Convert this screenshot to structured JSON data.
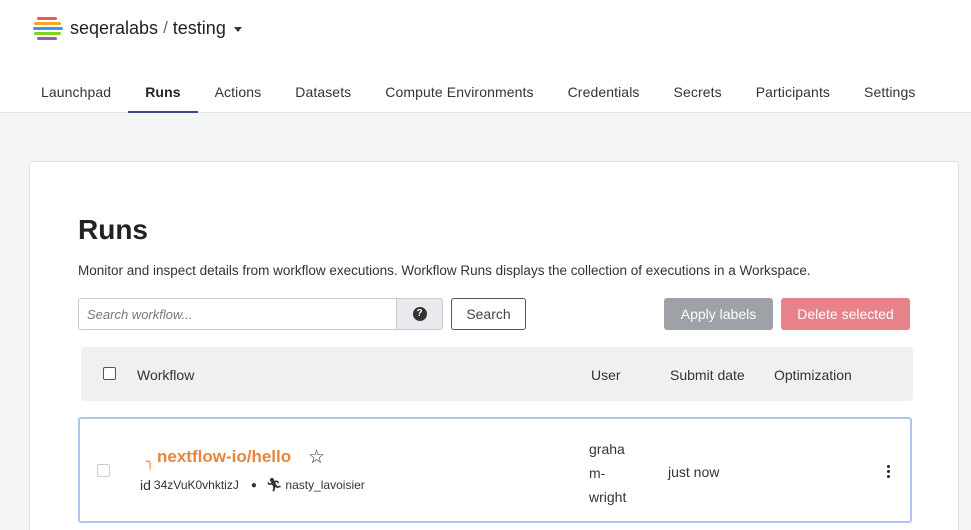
{
  "header": {
    "org": "seqeralabs",
    "separator": "/",
    "workspace": "testing",
    "logo_colors": [
      "#e85a5a",
      "#f5a623",
      "#4a90e2",
      "#7ed321",
      "#9b59b6"
    ]
  },
  "tabs": [
    {
      "label": "Launchpad",
      "active": false
    },
    {
      "label": "Runs",
      "active": true
    },
    {
      "label": "Actions",
      "active": false
    },
    {
      "label": "Datasets",
      "active": false
    },
    {
      "label": "Compute Environments",
      "active": false
    },
    {
      "label": "Credentials",
      "active": false
    },
    {
      "label": "Secrets",
      "active": false
    },
    {
      "label": "Participants",
      "active": false
    },
    {
      "label": "Settings",
      "active": false
    }
  ],
  "page": {
    "title": "Runs",
    "description": "Monitor and inspect details from workflow executions. Workflow Runs displays the collection of executions in a Workspace."
  },
  "search": {
    "placeholder": "Search workflow...",
    "value": "",
    "help_icon": "question-circle-icon",
    "button_label": "Search"
  },
  "actions": {
    "apply_labels": "Apply labels",
    "delete_selected": "Delete selected"
  },
  "table": {
    "headers": {
      "workflow": "Workflow",
      "user": "User",
      "submit_date": "Submit date",
      "optimization": "Optimization"
    },
    "rows": [
      {
        "status_icon": "spinner-icon",
        "workflow": "nextflow-io/hello",
        "id_label": "id",
        "id": "34zVuK0vhktizJ",
        "run_name": "nasty_lavoisier",
        "user_lines": [
          "graha",
          "m-",
          "wright"
        ],
        "submit_date": "just now",
        "optimization": ""
      }
    ]
  },
  "colors": {
    "accent": "#3b4a8f",
    "workflow_link": "#e8843e",
    "apply_btn": "#9ea1a6",
    "delete_btn": "#e8828a",
    "selected_row_border": "#aac8ee"
  }
}
